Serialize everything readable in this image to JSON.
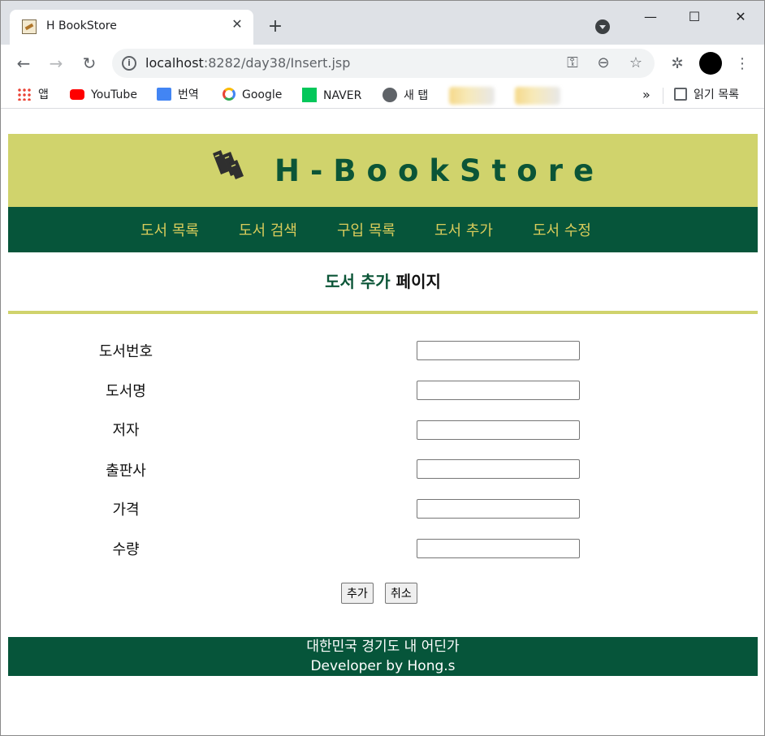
{
  "browser": {
    "tab_title": "H BookStore",
    "url_host": "localhost",
    "url_rest": ":8282/day38/Insert.jsp",
    "bookmarks": [
      {
        "label": "앱",
        "icon": "apps-grid-icon"
      },
      {
        "label": "YouTube",
        "icon": "youtube-icon"
      },
      {
        "label": "번역",
        "icon": "translate-icon"
      },
      {
        "label": "Google",
        "icon": "google-icon"
      },
      {
        "label": "NAVER",
        "icon": "naver-icon"
      },
      {
        "label": "새 탭",
        "icon": "globe-icon"
      }
    ],
    "reading_list": "읽기 목록",
    "overflow": "»"
  },
  "site": {
    "title": "H-BookStore",
    "accent_color": "#d0d36c",
    "primary_color": "#06553a",
    "nav": [
      "도서 목록",
      "도서 검색",
      "구입 목록",
      "도서 추가",
      "도서 수정"
    ]
  },
  "page": {
    "title_highlight": "도서 추가",
    "title_rest": " 페이지"
  },
  "form": {
    "fields": [
      {
        "label": "도서번호",
        "value": ""
      },
      {
        "label": "도서명",
        "value": ""
      },
      {
        "label": "저자",
        "value": ""
      },
      {
        "label": "출판사",
        "value": ""
      },
      {
        "label": "가격",
        "value": ""
      },
      {
        "label": "수량",
        "value": ""
      }
    ],
    "submit_label": "추가",
    "cancel_label": "취소"
  },
  "footer": {
    "line1": "대한민국 경기도 내 어딘가",
    "line2": "Developer by Hong.s"
  }
}
